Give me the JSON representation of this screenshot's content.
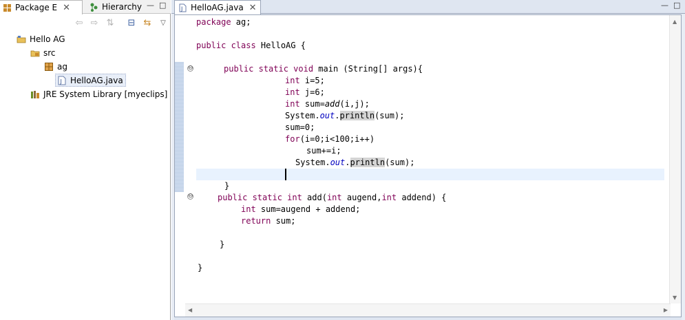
{
  "left_panel": {
    "tabs": [
      {
        "label": "Package E",
        "close": "✕"
      },
      {
        "label": "Hierarchy"
      }
    ],
    "window_controls": {
      "minimize": "—",
      "maximize": "□"
    },
    "toolbar": {
      "back": "⇦",
      "forward": "⇨",
      "link": "⇅",
      "collapse": "⊟",
      "sync": "⇆",
      "menu": "▽"
    },
    "tree": [
      {
        "label": "Hello AG",
        "icon": "project-folder-icon"
      },
      {
        "label": "src",
        "icon": "source-folder-icon"
      },
      {
        "label": "ag",
        "icon": "package-icon"
      },
      {
        "label": "HelloAG.java",
        "icon": "java-file-icon"
      },
      {
        "label": "JRE System Library [myeclips]",
        "icon": "library-icon"
      }
    ]
  },
  "editor": {
    "tab": {
      "label": "HelloAG.java",
      "close": "✕"
    },
    "window_controls": {
      "minimize": "—",
      "maximize": "□"
    },
    "fold_markers": [
      "⊖",
      "⊖"
    ],
    "scroll_arrows": {
      "up": "▲",
      "down": "▼",
      "left": "◀",
      "right": "▶"
    },
    "code": {
      "l1_kw": "package",
      "l1_rest": " ag;",
      "l2_kw": "public class",
      "l2_rest": " HelloAG {",
      "l3_kw": "public static void",
      "l3_rest": " main (String[] args){",
      "l4_kw": "int",
      "l4_rest": " i=5;",
      "l5_kw": "int",
      "l5_rest": " j=6;",
      "l6_kw": "int",
      "l6_a": " sum=",
      "l6_it": "add",
      "l6_b": "(i,j);",
      "l7_a": "System.",
      "l7_field": "out",
      "l7_b": ".",
      "l7_hl": "println",
      "l7_c": "(sum);",
      "l8": "sum=0;",
      "l9_kw": "for",
      "l9_rest": "(i=0;i<100;i++)",
      "l10": "sum+=i;",
      "l11_a": "System.",
      "l11_field": "out",
      "l11_b": ".",
      "l11_hl": "println",
      "l11_c": "(sum);",
      "l12": "}",
      "l13_kw": "public static int",
      "l13_a": " add(",
      "l13_kw2": "int",
      "l13_b": " augend,",
      "l13_kw3": "int",
      "l13_c": " addend) {",
      "l14_kw": "int",
      "l14_rest": " sum=augend + addend;",
      "l15_kw": "return",
      "l15_rest": " sum;",
      "l16": "}",
      "l17": "}"
    }
  },
  "colors": {
    "keyword": "#7f0055",
    "field": "#0000c0",
    "current_line": "#e8f2fe",
    "occurrence_highlight": "#d4d4d4"
  }
}
